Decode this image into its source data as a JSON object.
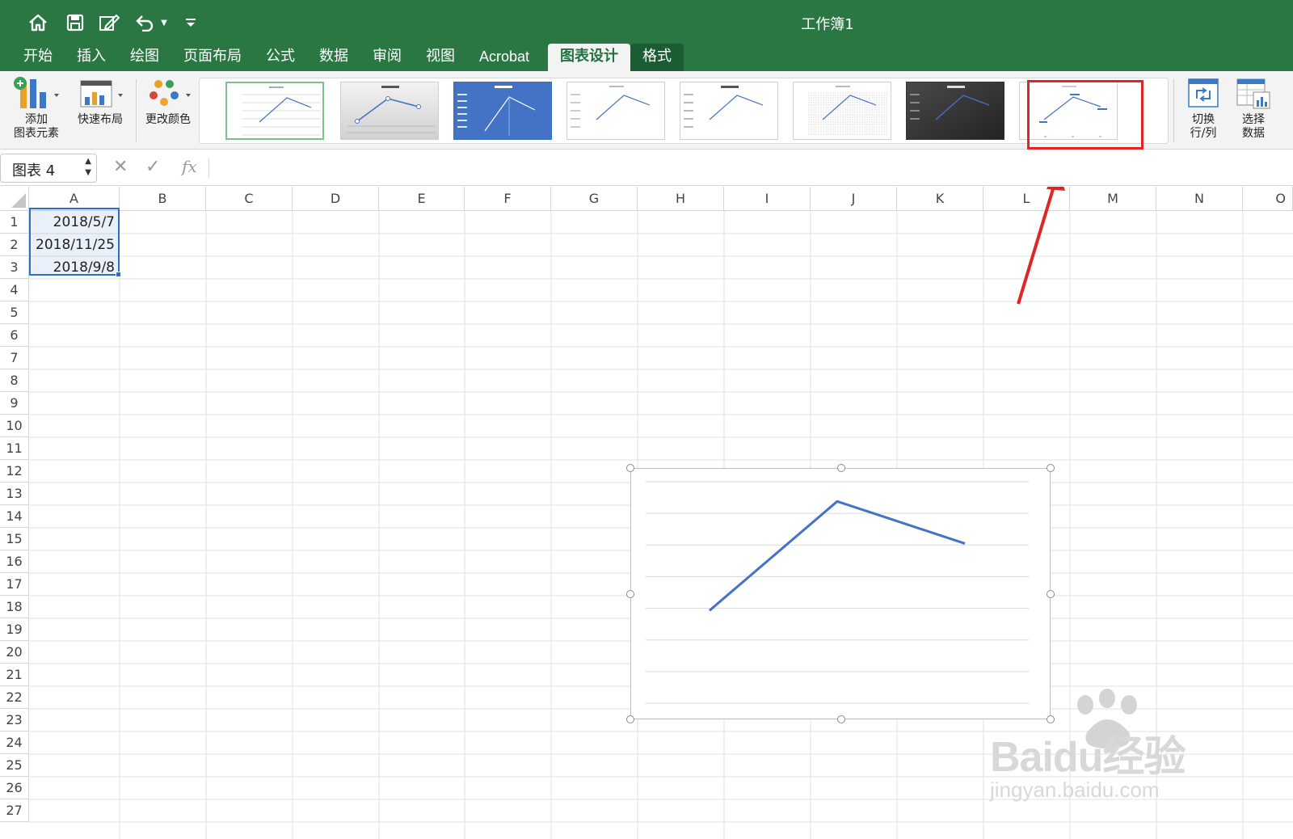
{
  "window": {
    "title": "工作簿1"
  },
  "quick_access": [
    "home-icon",
    "save-icon",
    "edit-icon",
    "undo-icon",
    "dropdown-icon",
    "customize-icon"
  ],
  "tabs": [
    {
      "label": "开始"
    },
    {
      "label": "插入"
    },
    {
      "label": "绘图"
    },
    {
      "label": "页面布局"
    },
    {
      "label": "公式"
    },
    {
      "label": "数据"
    },
    {
      "label": "审阅"
    },
    {
      "label": "视图"
    },
    {
      "label": "Acrobat"
    },
    {
      "label": "图表设计",
      "active": true
    },
    {
      "label": "格式"
    }
  ],
  "ribbon": {
    "add_element_line1": "添加",
    "add_element_line2": "图表元素",
    "quick_layout": "快速布局",
    "change_colors": "更改颜色",
    "switch_line1": "切换",
    "switch_line2": "行/列",
    "select_line1": "选择",
    "select_line2": "数据",
    "gallery_count": 8,
    "selected_style_index": 0,
    "highlighted_style_index": 7
  },
  "formula_bar": {
    "name_box": "图表 4",
    "cancel": "✕",
    "enter": "✓",
    "fx": "fx",
    "formula": ""
  },
  "columns": [
    "A",
    "B",
    "C",
    "D",
    "E",
    "F",
    "G",
    "H",
    "I",
    "J",
    "K",
    "L",
    "M",
    "N",
    "O"
  ],
  "rows": [
    "1",
    "2",
    "3",
    "4",
    "5",
    "6",
    "7",
    "8",
    "9",
    "10",
    "11",
    "12",
    "13",
    "14",
    "15",
    "16",
    "17",
    "18",
    "19",
    "20",
    "21",
    "22",
    "23",
    "24",
    "25",
    "26",
    "27"
  ],
  "cells": {
    "A1": "2018/5/7",
    "A2": "2018/11/25",
    "A3": "2018/9/8"
  },
  "chart_data": {
    "type": "line",
    "x": [
      1,
      2,
      3
    ],
    "series": [
      {
        "values": [
          "2018/5/7",
          "2018/11/25",
          "2018/9/8"
        ]
      }
    ],
    "grid": true,
    "color": "#4472c4"
  },
  "watermark": {
    "brand": "Baidu经验",
    "url": "jingyan.baidu.com"
  },
  "colors": {
    "ribbon_green": "#2b7744",
    "accent_red": "#e02525",
    "selection_blue": "#2e6fc6"
  }
}
